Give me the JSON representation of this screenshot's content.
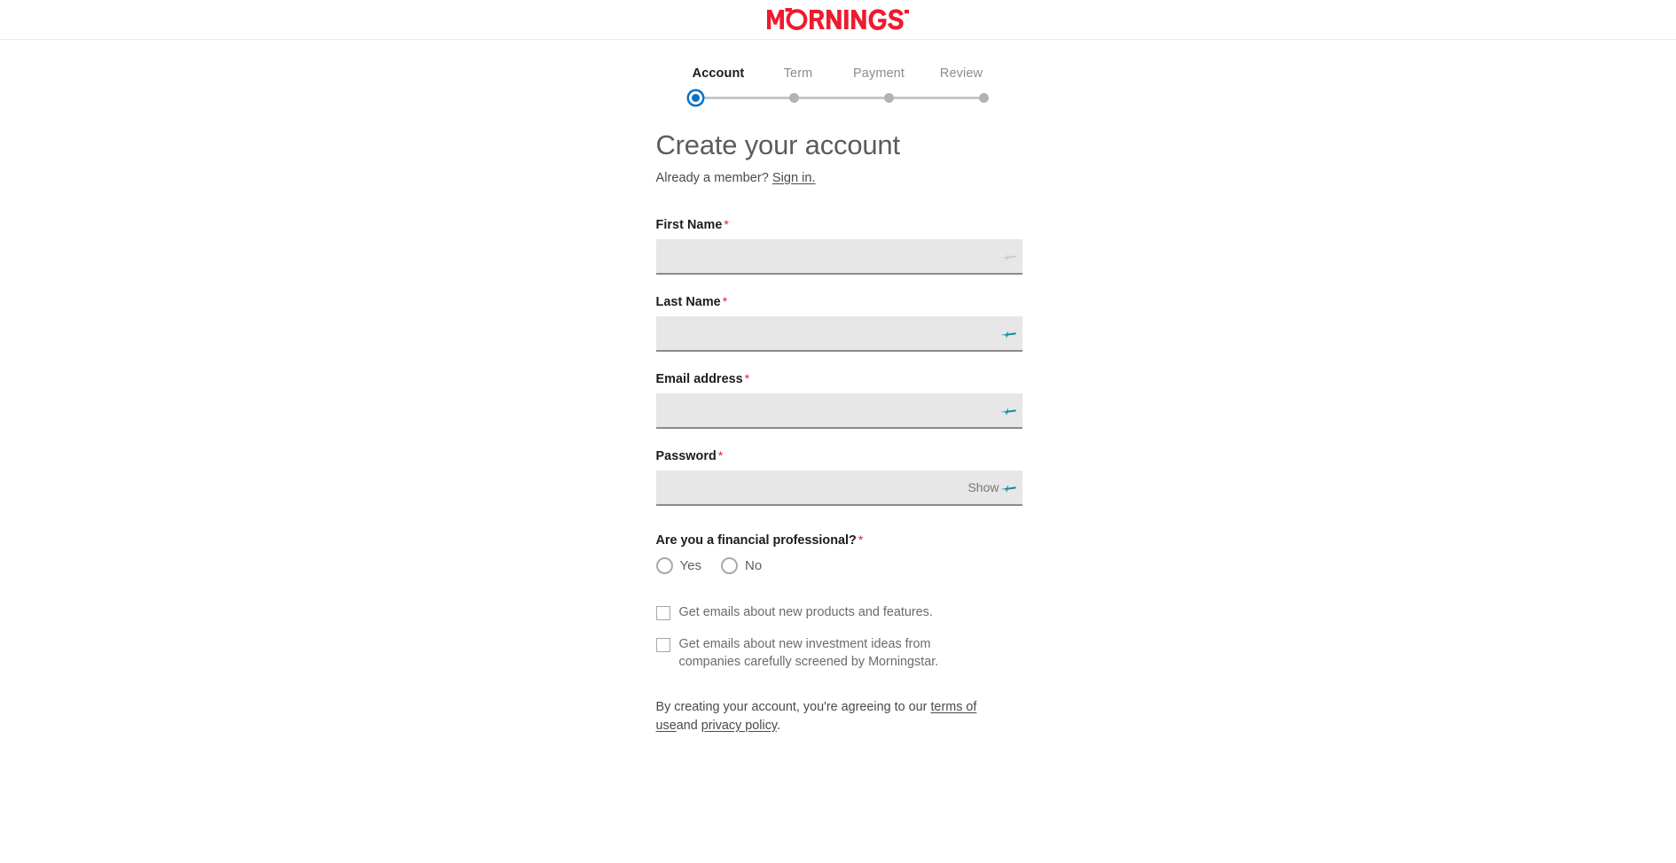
{
  "header": {
    "logo_text": "MORNINGSTAR",
    "logo_color": "#ee1b2e"
  },
  "stepper": {
    "active_index": 0,
    "active_color": "#0a72c4",
    "inactive_color": "#b0b2b5",
    "steps": [
      {
        "label": "Account"
      },
      {
        "label": "Term"
      },
      {
        "label": "Payment"
      },
      {
        "label": "Review"
      }
    ]
  },
  "main": {
    "title": "Create your account",
    "member_prompt": "Already a member?",
    "signin_link": "Sign in.",
    "required_marker": "*",
    "fields": [
      {
        "label": "First Name",
        "required": true,
        "value": "",
        "placeholder": ""
      },
      {
        "label": "Last Name",
        "required": true,
        "value": "",
        "placeholder": ""
      },
      {
        "label": "Email address",
        "required": true,
        "value": "",
        "placeholder": ""
      },
      {
        "label": "Password",
        "required": true,
        "value": "",
        "placeholder": "",
        "show_label": "Show"
      }
    ],
    "radio_question": "Are you a financial professional?",
    "radio_options": [
      {
        "label": "Yes",
        "selected": false
      },
      {
        "label": "No",
        "selected": false
      }
    ],
    "checkboxes": [
      {
        "label": "Get emails about new products and features.",
        "checked": false
      },
      {
        "label": "Get emails about new investment ideas from companies carefully screened by Morningstar.",
        "checked": false
      }
    ],
    "terms": {
      "prefix": "By creating your account, you're agreeing to our",
      "terms_link": "terms of use",
      "conjunction": "and",
      "privacy_link": "privacy policy",
      "suffix": "."
    }
  },
  "icons": {
    "password_manager": "key-icon",
    "password_manager_color": "#0f8f9e"
  }
}
